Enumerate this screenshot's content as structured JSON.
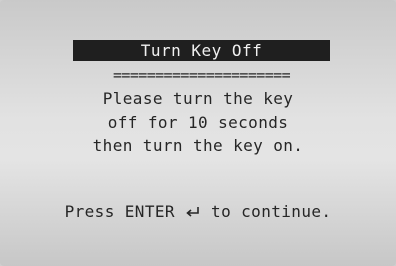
{
  "screen": {
    "title": "Turn Key Off",
    "separator": "=====================",
    "message_lines": [
      "Please turn the key",
      "off for 10 seconds",
      "then turn the key on."
    ],
    "prompt_before": "Press ENTER",
    "prompt_after": " to continue.",
    "icons": {
      "enter": "enter-return-arrow-icon"
    }
  }
}
